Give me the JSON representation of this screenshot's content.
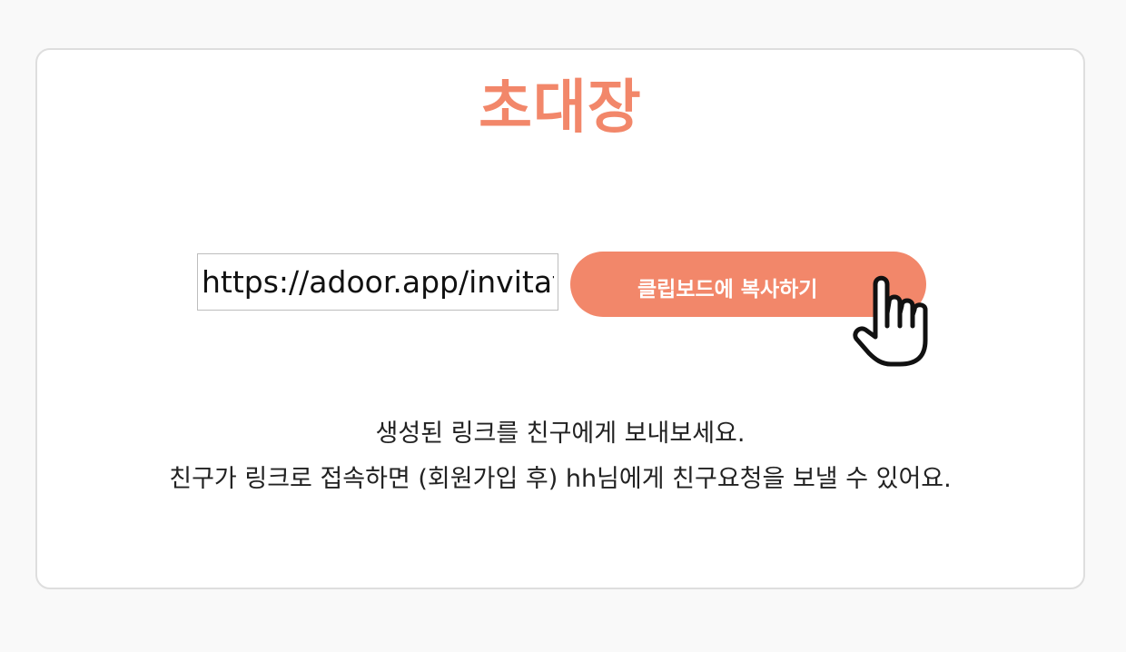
{
  "page": {
    "title": "초대장",
    "link_value": "https://adoor.app/invitation",
    "copy_button_label": "클립보드에 복사하기",
    "description_line1": "생성된 링크를 친구에게 보내보세요.",
    "description_line2": "친구가 링크로 접속하면 (회원가입 후) hh님에게 친구요청을 보낼 수 있어요."
  },
  "icons": {
    "cursor": "pointing-hand-icon"
  },
  "colors": {
    "accent": "#f2876a",
    "page_background": "#f9f9f9",
    "card_background": "#ffffff",
    "card_border": "#dedede",
    "text": "#222222"
  }
}
